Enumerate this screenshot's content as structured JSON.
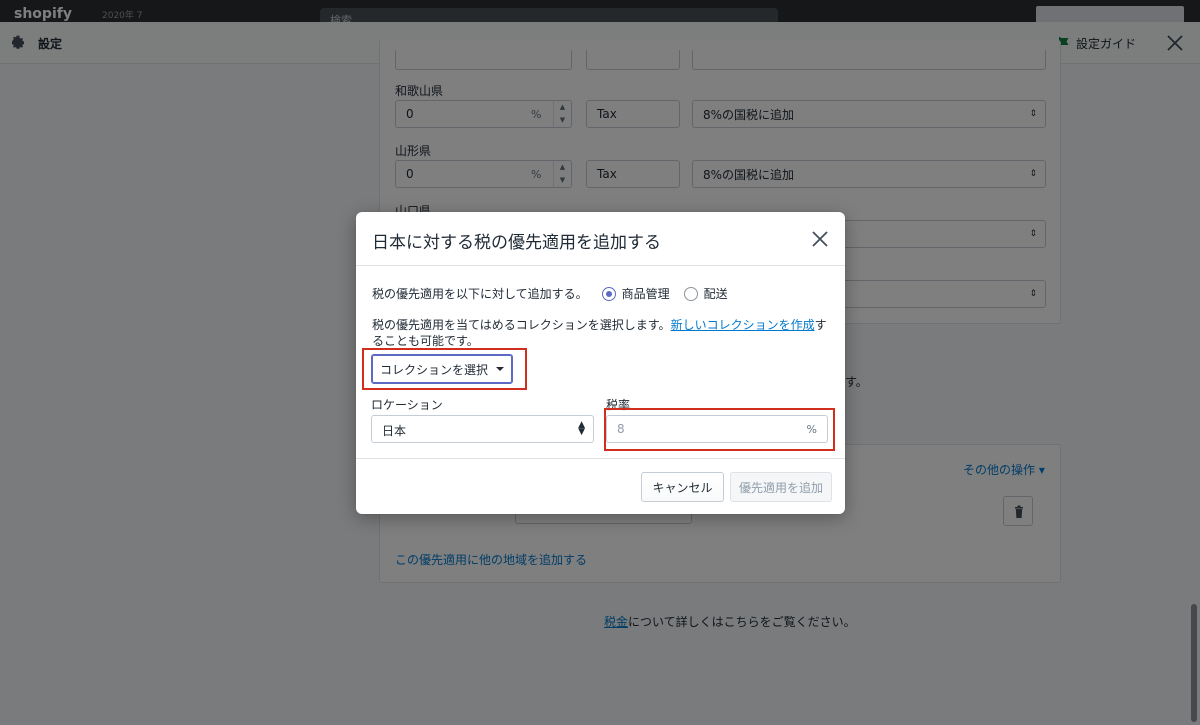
{
  "topbar": {
    "logo": "shopify",
    "store": "2020年 7",
    "search_placeholder": "検索"
  },
  "settings": {
    "title": "設定",
    "guide_label": "設定ガイド"
  },
  "background": {
    "prefectures": [
      {
        "name": "和歌山県",
        "rate": "0",
        "unit": "%",
        "tax_name": "Tax",
        "rule": "8%の国税に追加"
      },
      {
        "name": "山形県",
        "rate": "0",
        "unit": "%",
        "tax_name": "Tax",
        "rule": "8%の国税に追加"
      },
      {
        "name": "山口県",
        "rate": "",
        "unit": "",
        "tax_name": "",
        "rule": ""
      }
    ],
    "partial_text": "す。",
    "more_actions": "その他の操作",
    "add_region_link": "この優先適用に他の地域を追加する",
    "footer_link": "税金",
    "footer_text": "について詳しくはこちらをご覧ください。"
  },
  "modal": {
    "title": "日本に対する税の優先適用を追加する",
    "apply_to_label": "税の優先適用を以下に対して追加する。",
    "options": [
      {
        "label": "商品管理",
        "checked": true
      },
      {
        "label": "配送",
        "checked": false
      }
    ],
    "desc_before": "税の優先適用を当てはめるコレクションを選択します。",
    "desc_link": "新しいコレクションを作成",
    "desc_after": "することも可能です。",
    "collection_button": "コレクションを選択",
    "location_label": "ロケーション",
    "location_value": "日本",
    "rate_label": "税率",
    "rate_placeholder": "8",
    "rate_unit": "%",
    "cancel_button": "キャンセル",
    "add_button": "優先適用を追加"
  },
  "colors": {
    "accent": "#5c6ac4",
    "link": "#007ace",
    "highlight": "#d22e1d"
  }
}
